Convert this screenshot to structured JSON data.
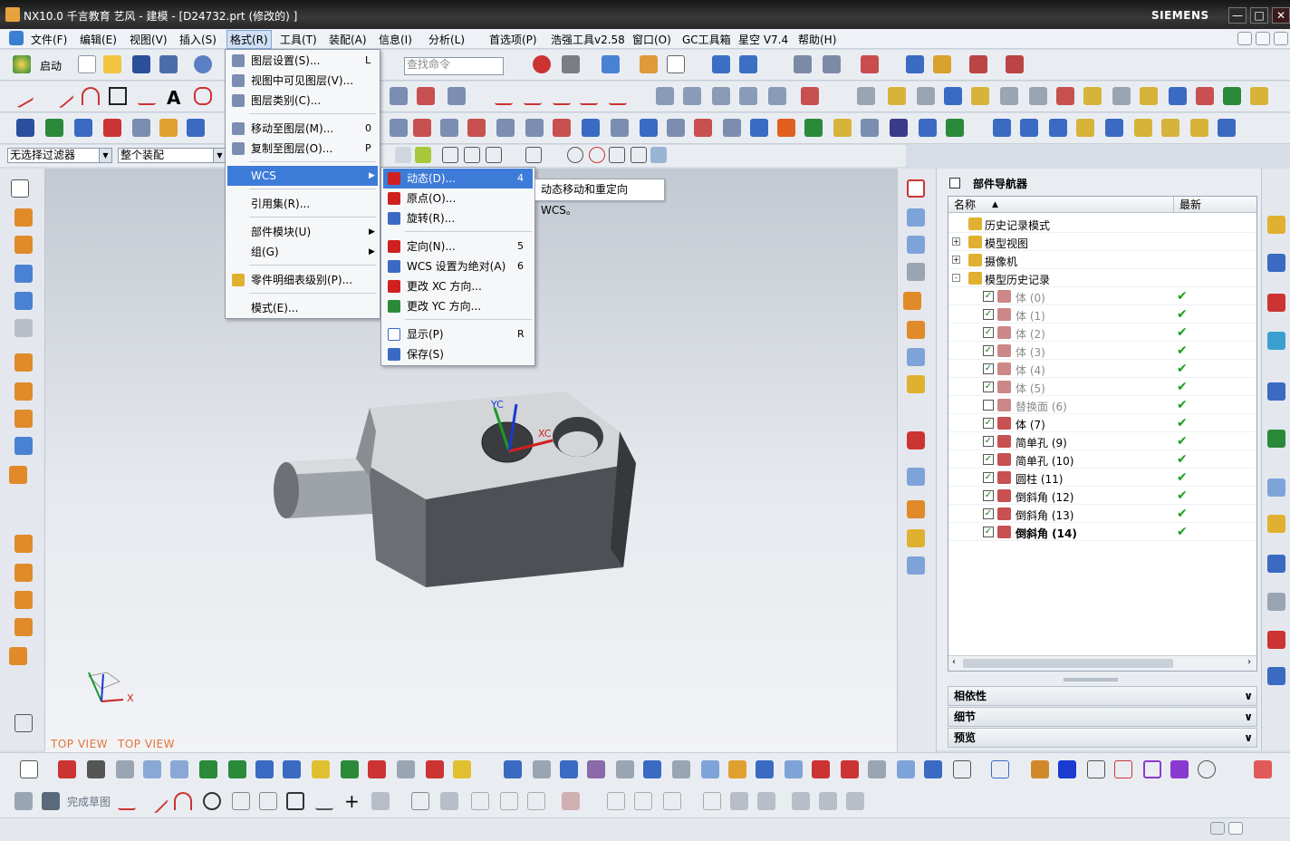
{
  "titlebar": {
    "title": "NX10.0 千言教育 艺风 - 建模 - [D24732.prt  (修改的) ]",
    "brand": "SIEMENS",
    "minimize": "—",
    "maximize": "□",
    "close": "✕"
  },
  "menubar": {
    "items": [
      "文件(F)",
      "编辑(E)",
      "视图(V)",
      "插入(S)",
      "格式(R)",
      "工具(T)",
      "装配(A)",
      "信息(I)",
      "分析(L)",
      "首选项(P)",
      "浩强工具v2.58",
      "窗口(O)",
      "GC工具箱",
      "星空 V7.4",
      "帮助(H)"
    ],
    "active_index": 4
  },
  "standard_toolbar": {
    "start_label": "启动",
    "search_placeholder": "查找命令"
  },
  "filter_bar": {
    "filter_value": "无选择过滤器",
    "scope_value": "整个装配"
  },
  "format_menu": {
    "items": [
      {
        "label": "图层设置(S)...",
        "key": "L"
      },
      {
        "label": "视图中可见图层(V)...",
        "key": ""
      },
      {
        "label": "图层类别(C)...",
        "key": ""
      },
      {
        "label": "移动至图层(M)...",
        "key": "0"
      },
      {
        "label": "复制至图层(O)...",
        "key": "P"
      },
      {
        "label": "WCS",
        "key": ""
      },
      {
        "label": "引用集(R)...",
        "key": ""
      },
      {
        "label": "部件模块(U)",
        "key": ""
      },
      {
        "label": "组(G)",
        "key": ""
      },
      {
        "label": "零件明细表级别(P)...",
        "key": ""
      },
      {
        "label": "模式(E)...",
        "key": ""
      }
    ]
  },
  "wcs_menu": {
    "items": [
      {
        "label": "动态(D)...",
        "key": "4"
      },
      {
        "label": "原点(O)...",
        "key": ""
      },
      {
        "label": "旋转(R)...",
        "key": ""
      },
      {
        "label": "定向(N)...",
        "key": "5"
      },
      {
        "label": "WCS 设置为绝对(A)",
        "key": "6"
      },
      {
        "label": "更改 XC 方向...",
        "key": ""
      },
      {
        "label": "更改 YC 方向...",
        "key": ""
      },
      {
        "label": "显示(P)",
        "key": "R"
      },
      {
        "label": "保存(S)",
        "key": ""
      }
    ]
  },
  "tooltip": "动态移动和重定向 WCS。",
  "viewport": {
    "view_label_1": "TOP VIEW",
    "view_label_2": "TOP VIEW",
    "axis_yc": "YC",
    "axis_xc": "XC",
    "triad_x": "X"
  },
  "part_navigator": {
    "title": "部件导航器",
    "col_name": "名称",
    "col_latest": "最新",
    "rows": [
      {
        "label": "历史记录模式",
        "level": 0,
        "check": false,
        "expander": ""
      },
      {
        "label": "模型视图",
        "level": 0,
        "check": false,
        "expander": "+"
      },
      {
        "label": "摄像机",
        "level": 0,
        "check": false,
        "expander": "+"
      },
      {
        "label": "模型历史记录",
        "level": 0,
        "check": false,
        "expander": "-"
      },
      {
        "label": "体 (0)",
        "level": 1,
        "check": true,
        "latest": true,
        "dim": true
      },
      {
        "label": "体 (1)",
        "level": 1,
        "check": true,
        "latest": true,
        "dim": true
      },
      {
        "label": "体 (2)",
        "level": 1,
        "check": true,
        "latest": true,
        "dim": true
      },
      {
        "label": "体 (3)",
        "level": 1,
        "check": true,
        "latest": true,
        "dim": true
      },
      {
        "label": "体 (4)",
        "level": 1,
        "check": true,
        "latest": true,
        "dim": true
      },
      {
        "label": "体 (5)",
        "level": 1,
        "check": true,
        "latest": true,
        "dim": true
      },
      {
        "label": "替换面 (6)",
        "level": 1,
        "check": false,
        "latest": true,
        "dim": true
      },
      {
        "label": "体 (7)",
        "level": 1,
        "check": true,
        "latest": true
      },
      {
        "label": "简单孔 (9)",
        "level": 1,
        "check": true,
        "latest": true
      },
      {
        "label": "简单孔 (10)",
        "level": 1,
        "check": true,
        "latest": true
      },
      {
        "label": "圆柱 (11)",
        "level": 1,
        "check": true,
        "latest": true
      },
      {
        "label": "倒斜角 (12)",
        "level": 1,
        "check": true,
        "latest": true
      },
      {
        "label": "倒斜角 (13)",
        "level": 1,
        "check": true,
        "latest": true
      },
      {
        "label": "倒斜角 (14)",
        "level": 1,
        "check": true,
        "latest": true,
        "bold": true
      }
    ],
    "panels": [
      "相依性",
      "细节",
      "预览"
    ]
  },
  "bottom_toolbar": {
    "finish_sketch": "完成草图"
  }
}
